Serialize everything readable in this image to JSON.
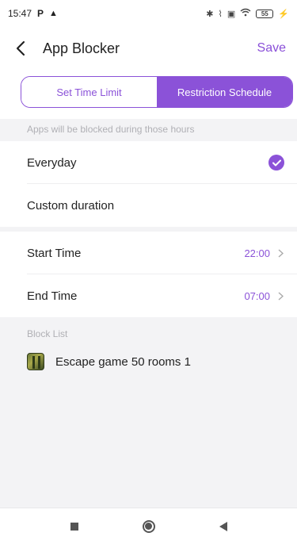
{
  "status_bar": {
    "time": "15:47",
    "left_icons": [
      "p-icon",
      "warning-triangle-icon"
    ],
    "right_icons": [
      "bluetooth-icon",
      "vibrate-icon",
      "sim-icon",
      "wifi-icon",
      "battery-icon",
      "charging-icon"
    ],
    "battery_level": "55"
  },
  "header": {
    "title": "App Blocker",
    "save_label": "Save"
  },
  "segmented": {
    "tabs": [
      {
        "label": "Set Time Limit",
        "active": false
      },
      {
        "label": "Restriction Schedule",
        "active": true
      }
    ]
  },
  "schedule": {
    "info_label": "Apps will be blocked during those hours",
    "options": [
      {
        "label": "Everyday",
        "selected": true
      },
      {
        "label": "Custom duration",
        "selected": false
      }
    ]
  },
  "times": {
    "start_label": "Start Time",
    "start_value": "22:00",
    "end_label": "End Time",
    "end_value": "07:00"
  },
  "block_list": {
    "label": "Block List",
    "apps": [
      {
        "name": "Escape game 50 rooms 1",
        "icon": "escape-game-app-icon"
      }
    ]
  },
  "nav_bar": {
    "buttons": [
      "recents-button",
      "home-button",
      "back-button"
    ]
  },
  "colors": {
    "accent": "#8b52d8",
    "background": "#f3f3f5",
    "label_gray": "#b0b0b5"
  }
}
